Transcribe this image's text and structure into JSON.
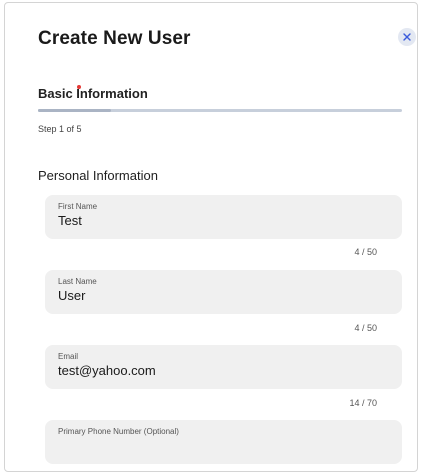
{
  "dialog": {
    "title": "Create New User",
    "close_icon": "close-icon"
  },
  "step": {
    "title": "Basic Information",
    "count": "Step 1 of 5",
    "progress": 0.2
  },
  "section": {
    "title": "Personal Information"
  },
  "fields": {
    "first_name": {
      "label": "First Name",
      "value": "Test",
      "counter": "4 / 50"
    },
    "last_name": {
      "label": "Last Name",
      "value": "User",
      "counter": "4 / 50"
    },
    "email": {
      "label": "Email",
      "value": "test@yahoo.com",
      "counter": "14 / 70"
    },
    "phone": {
      "label": "Primary Phone Number (Optional)",
      "value": ""
    }
  },
  "colors": {
    "close_bg": "#e3e8f2",
    "close_icon": "#3b5bdb",
    "field_bg": "#f0f0f0",
    "progress_track": "#c7cfdb",
    "accent_dot": "#e53935"
  }
}
